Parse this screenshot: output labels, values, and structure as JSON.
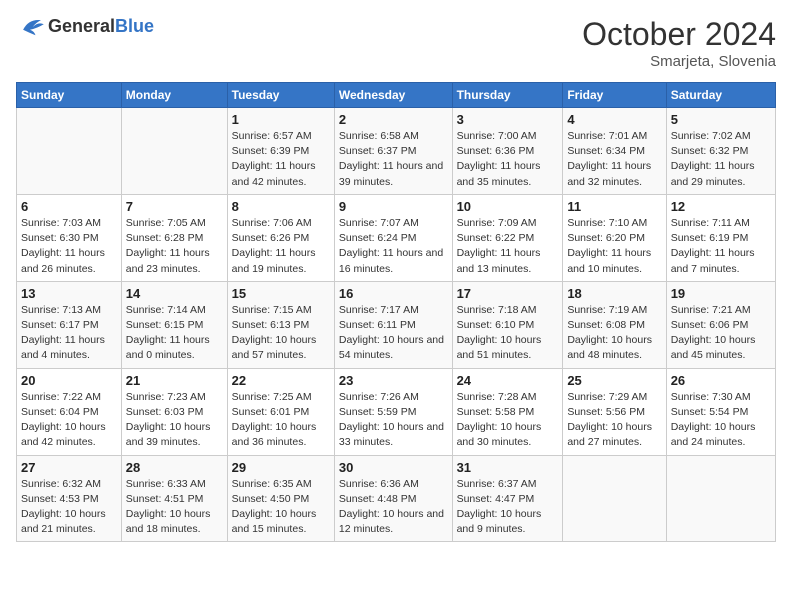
{
  "header": {
    "logo_general": "General",
    "logo_blue": "Blue",
    "month_year": "October 2024",
    "location": "Smarjeta, Slovenia"
  },
  "weekdays": [
    "Sunday",
    "Monday",
    "Tuesday",
    "Wednesday",
    "Thursday",
    "Friday",
    "Saturday"
  ],
  "weeks": [
    [
      {
        "day": "",
        "info": ""
      },
      {
        "day": "",
        "info": ""
      },
      {
        "day": "1",
        "info": "Sunrise: 6:57 AM\nSunset: 6:39 PM\nDaylight: 11 hours and 42 minutes."
      },
      {
        "day": "2",
        "info": "Sunrise: 6:58 AM\nSunset: 6:37 PM\nDaylight: 11 hours and 39 minutes."
      },
      {
        "day": "3",
        "info": "Sunrise: 7:00 AM\nSunset: 6:36 PM\nDaylight: 11 hours and 35 minutes."
      },
      {
        "day": "4",
        "info": "Sunrise: 7:01 AM\nSunset: 6:34 PM\nDaylight: 11 hours and 32 minutes."
      },
      {
        "day": "5",
        "info": "Sunrise: 7:02 AM\nSunset: 6:32 PM\nDaylight: 11 hours and 29 minutes."
      }
    ],
    [
      {
        "day": "6",
        "info": "Sunrise: 7:03 AM\nSunset: 6:30 PM\nDaylight: 11 hours and 26 minutes."
      },
      {
        "day": "7",
        "info": "Sunrise: 7:05 AM\nSunset: 6:28 PM\nDaylight: 11 hours and 23 minutes."
      },
      {
        "day": "8",
        "info": "Sunrise: 7:06 AM\nSunset: 6:26 PM\nDaylight: 11 hours and 19 minutes."
      },
      {
        "day": "9",
        "info": "Sunrise: 7:07 AM\nSunset: 6:24 PM\nDaylight: 11 hours and 16 minutes."
      },
      {
        "day": "10",
        "info": "Sunrise: 7:09 AM\nSunset: 6:22 PM\nDaylight: 11 hours and 13 minutes."
      },
      {
        "day": "11",
        "info": "Sunrise: 7:10 AM\nSunset: 6:20 PM\nDaylight: 11 hours and 10 minutes."
      },
      {
        "day": "12",
        "info": "Sunrise: 7:11 AM\nSunset: 6:19 PM\nDaylight: 11 hours and 7 minutes."
      }
    ],
    [
      {
        "day": "13",
        "info": "Sunrise: 7:13 AM\nSunset: 6:17 PM\nDaylight: 11 hours and 4 minutes."
      },
      {
        "day": "14",
        "info": "Sunrise: 7:14 AM\nSunset: 6:15 PM\nDaylight: 11 hours and 0 minutes."
      },
      {
        "day": "15",
        "info": "Sunrise: 7:15 AM\nSunset: 6:13 PM\nDaylight: 10 hours and 57 minutes."
      },
      {
        "day": "16",
        "info": "Sunrise: 7:17 AM\nSunset: 6:11 PM\nDaylight: 10 hours and 54 minutes."
      },
      {
        "day": "17",
        "info": "Sunrise: 7:18 AM\nSunset: 6:10 PM\nDaylight: 10 hours and 51 minutes."
      },
      {
        "day": "18",
        "info": "Sunrise: 7:19 AM\nSunset: 6:08 PM\nDaylight: 10 hours and 48 minutes."
      },
      {
        "day": "19",
        "info": "Sunrise: 7:21 AM\nSunset: 6:06 PM\nDaylight: 10 hours and 45 minutes."
      }
    ],
    [
      {
        "day": "20",
        "info": "Sunrise: 7:22 AM\nSunset: 6:04 PM\nDaylight: 10 hours and 42 minutes."
      },
      {
        "day": "21",
        "info": "Sunrise: 7:23 AM\nSunset: 6:03 PM\nDaylight: 10 hours and 39 minutes."
      },
      {
        "day": "22",
        "info": "Sunrise: 7:25 AM\nSunset: 6:01 PM\nDaylight: 10 hours and 36 minutes."
      },
      {
        "day": "23",
        "info": "Sunrise: 7:26 AM\nSunset: 5:59 PM\nDaylight: 10 hours and 33 minutes."
      },
      {
        "day": "24",
        "info": "Sunrise: 7:28 AM\nSunset: 5:58 PM\nDaylight: 10 hours and 30 minutes."
      },
      {
        "day": "25",
        "info": "Sunrise: 7:29 AM\nSunset: 5:56 PM\nDaylight: 10 hours and 27 minutes."
      },
      {
        "day": "26",
        "info": "Sunrise: 7:30 AM\nSunset: 5:54 PM\nDaylight: 10 hours and 24 minutes."
      }
    ],
    [
      {
        "day": "27",
        "info": "Sunrise: 6:32 AM\nSunset: 4:53 PM\nDaylight: 10 hours and 21 minutes."
      },
      {
        "day": "28",
        "info": "Sunrise: 6:33 AM\nSunset: 4:51 PM\nDaylight: 10 hours and 18 minutes."
      },
      {
        "day": "29",
        "info": "Sunrise: 6:35 AM\nSunset: 4:50 PM\nDaylight: 10 hours and 15 minutes."
      },
      {
        "day": "30",
        "info": "Sunrise: 6:36 AM\nSunset: 4:48 PM\nDaylight: 10 hours and 12 minutes."
      },
      {
        "day": "31",
        "info": "Sunrise: 6:37 AM\nSunset: 4:47 PM\nDaylight: 10 hours and 9 minutes."
      },
      {
        "day": "",
        "info": ""
      },
      {
        "day": "",
        "info": ""
      }
    ]
  ]
}
